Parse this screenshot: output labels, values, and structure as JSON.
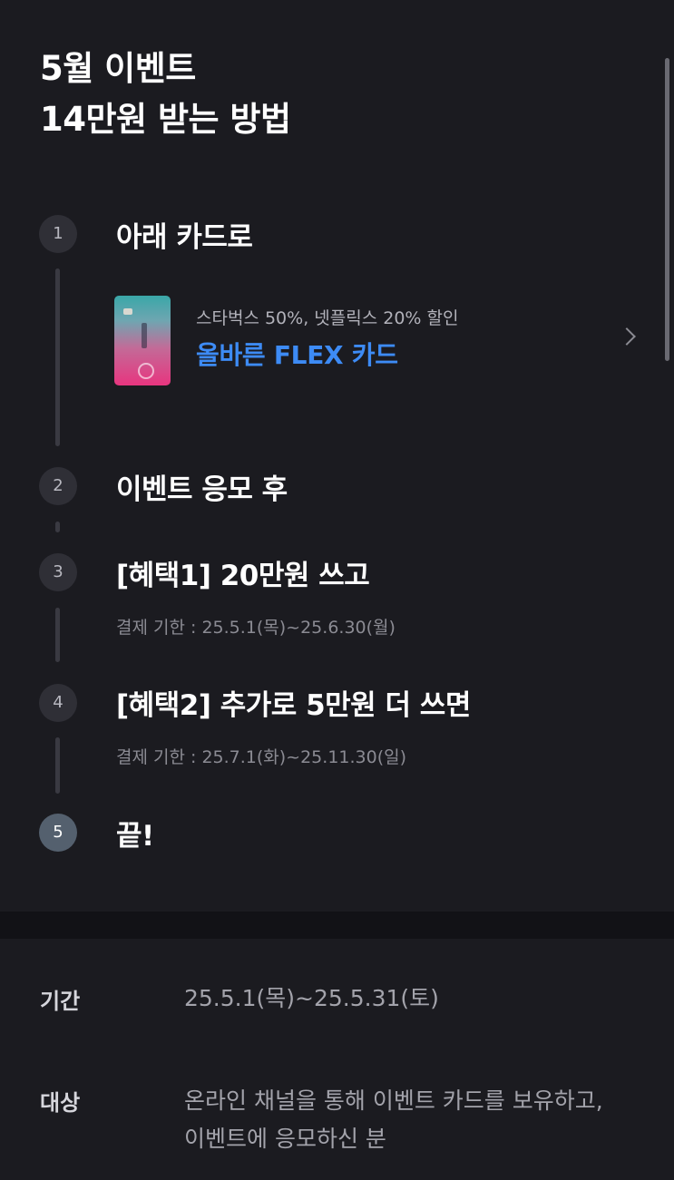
{
  "header": {
    "title_line1": "5월 이벤트",
    "title_line2": "14만원 받는 방법"
  },
  "steps": [
    {
      "number": "1",
      "title": "아래 카드로"
    },
    {
      "number": "2",
      "title": "이벤트 응모 후"
    },
    {
      "number": "3",
      "title": "[혜택1] 20만원 쓰고",
      "sub": "결제 기한 : 25.5.1(목)~25.6.30(월)"
    },
    {
      "number": "4",
      "title": "[혜택2] 추가로 5만원 더 쓰면",
      "sub": "결제 기한 : 25.7.1(화)~25.11.30(일)"
    },
    {
      "number": "5",
      "title": "끝!"
    }
  ],
  "card": {
    "description": "스타벅스 50%, 넷플릭스 20% 할인",
    "name": "올바른 FLEX 카드",
    "link_icon": "chevron-right-icon",
    "accent_color": "#3d8bf5"
  },
  "info": {
    "period_label": "기간",
    "period_value": "25.5.1(목)~25.5.31(토)",
    "target_label": "대상",
    "target_value_line1": "온라인 채널을 통해 이벤트 카드를 보유하고,",
    "target_value_line2": "이벤트에 응모하신 분"
  }
}
